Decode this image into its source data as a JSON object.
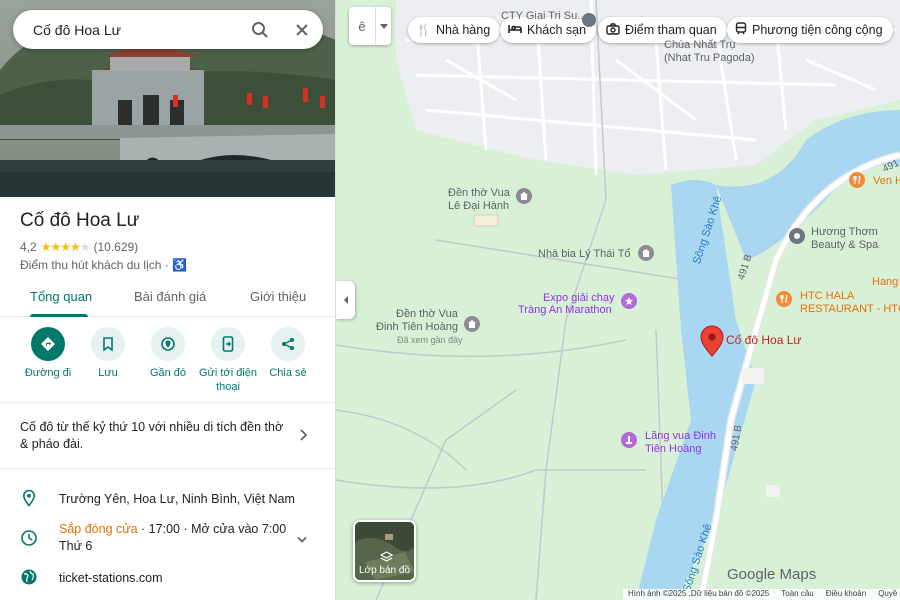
{
  "search": {
    "query": "Cố đô Hoa Lư"
  },
  "place": {
    "name": "Cố đô Hoa Lư",
    "rating": "4,2",
    "stars": 4.2,
    "review_count": "(10.629)",
    "category": "Điểm thu hút khách du lịch ·"
  },
  "tabs": [
    {
      "label": "Tổng quan",
      "active": true
    },
    {
      "label": "Bài đánh giá",
      "active": false
    },
    {
      "label": "Giới thiệu",
      "active": false
    }
  ],
  "actions": [
    {
      "label": "Đường đi",
      "icon": "directions-icon"
    },
    {
      "label": "Lưu",
      "icon": "bookmark-icon"
    },
    {
      "label": "Gần đó",
      "icon": "nearby-icon"
    },
    {
      "label": "Gửi tới điện thoại",
      "icon": "phone-icon"
    },
    {
      "label": "Chia sẻ",
      "icon": "share-icon"
    }
  ],
  "description": "Cố đô từ thế kỷ thứ 10 với nhiều di tích đền thờ & pháo đài.",
  "details": {
    "address": "Trường Yên, Hoa Lư, Ninh Bình, Việt Nam",
    "hours_status": "Sắp đóng cửa",
    "hours_text": " · 17:00 · Mở cửa vào 7:00",
    "hours_day": "Thứ 6",
    "website": "ticket-stations.com"
  },
  "map": {
    "lang_label": "ê",
    "chips": [
      "Nhà hàng",
      "Khách sạn",
      "Điểm tham quan",
      "Phương tiện công cộng"
    ],
    "labels": {
      "cty": "CTY Giai Tri Su...",
      "chua1": "Chùa Nhất Trụ",
      "chua2": "(Nhat Tru Pagoda)",
      "le_dai_hanh_1": "Đền thờ Vua",
      "le_dai_hanh_2": "Lê Đại Hành",
      "ly_thai_to": "Nhà bia Lý Thái Tổ",
      "expo1": "Expo giải chạy",
      "expo2": "Tràng An Marathon",
      "dinh_1": "Đền thờ Vua",
      "dinh_2": "Đinh Tiên Hoàng",
      "visited": "Đã xem gần đây",
      "lang_vua_1": "Lăng vua Đinh",
      "lang_vua_2": "Tiên Hoàng",
      "huong_thom_1": "Hương Thơm",
      "huong_thom_2": "Beauty & Spa",
      "htc_1": "HTC HALA",
      "htc_2": "RESTAURANT - HTC",
      "ven": "Ven H",
      "hang": "Hang",
      "selected": "Cố đô Hoa Lư",
      "river_1": "Sông Sào Khê",
      "river_2": "Sông Sào Khê",
      "road_1": "491 B",
      "road_2": "491 B",
      "road_3": "491 B"
    },
    "layers_label": "Lớp bản đồ",
    "logo": "Google Maps",
    "footer": [
      "Hình ảnh ©2025 ,Dữ liệu bản đồ ©2025",
      "Toàn cầu",
      "Điều khoản",
      "Quyề"
    ]
  },
  "colors": {
    "accent": "#00796b",
    "pin": "#ea4335",
    "water": "#a9d7f1",
    "land": "#d8f0d5"
  }
}
